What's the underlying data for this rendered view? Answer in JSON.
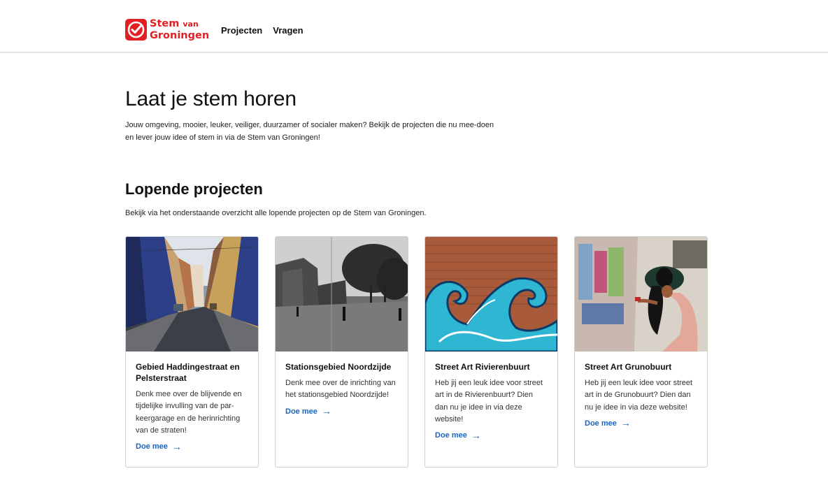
{
  "brand": {
    "line1": "Stem",
    "line1_small": "van",
    "line2": "Groningen",
    "color": "#e31f26"
  },
  "nav": {
    "items": [
      {
        "label": "Projecten"
      },
      {
        "label": "Vragen"
      }
    ]
  },
  "hero": {
    "title": "Laat je stem horen",
    "text": "Jouw omgeving, mooier, leuker, veiliger, duurzamer of socialer maken? Bekijk de projecten die nu mee-doen en lever jouw idee of stem in via de Stem van Groningen!"
  },
  "section": {
    "title": "Lopende projecten",
    "text": "Bekijk via het onderstaande overzicht alle lopende projecten op de Stem van Groningen."
  },
  "cards": [
    {
      "title": "Gebied Haddingestraat en Pelsterstraat",
      "desc": "Denk mee over de blijvende en tijdelijke invulling van de par-keergarage en de herinrichting van de straten!",
      "cta": "Doe mee",
      "image": "street-photo"
    },
    {
      "title": "Stationsgebied Noordzijde",
      "desc": "Denk mee over de inrichting van het stationsgebied Noordzijde!",
      "cta": "Doe mee",
      "image": "historic-photo"
    },
    {
      "title": "Street Art Rivierenbuurt",
      "desc": "Heb jij een leuk idee voor street art in de Rivierenbuurt? Dien dan nu je idee in via deze website!",
      "cta": "Doe mee",
      "image": "wave-mural-photo"
    },
    {
      "title": "Street Art Grunobuurt",
      "desc": "Heb jij een leuk idee voor street art in de Grunobuurt? Dien dan nu je idee in via deze website!",
      "cta": "Doe mee",
      "image": "painter-photo"
    }
  ],
  "colors": {
    "accent": "#1a64c0",
    "border": "#cfcfcf"
  }
}
